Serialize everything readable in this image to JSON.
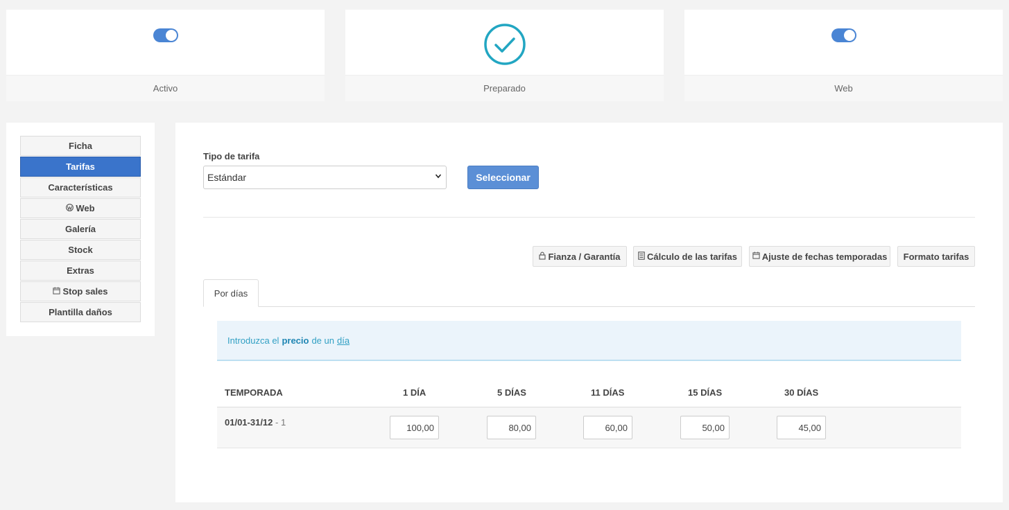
{
  "status_cards": {
    "activo": {
      "label": "Activo",
      "on": true
    },
    "preparado": {
      "label": "Preparado",
      "checked": true
    },
    "web": {
      "label": "Web",
      "on": true
    }
  },
  "colors": {
    "accent": "#3a74cb",
    "toggle": "#4a85d4",
    "check": "#22a6c2",
    "info_text": "#31a0c4"
  },
  "sidebar": {
    "items": [
      {
        "label": "Ficha",
        "icon": ""
      },
      {
        "label": "Tarifas",
        "icon": "",
        "active": true
      },
      {
        "label": "Características",
        "icon": ""
      },
      {
        "label": "Web",
        "icon": "wordpress-icon"
      },
      {
        "label": "Galería",
        "icon": ""
      },
      {
        "label": "Stock",
        "icon": ""
      },
      {
        "label": "Extras",
        "icon": ""
      },
      {
        "label": "Stop sales",
        "icon": "calendar-icon"
      },
      {
        "label": "Plantilla daños",
        "icon": ""
      }
    ]
  },
  "main": {
    "tipo_label": "Tipo de tarifa",
    "tipo_value": "Estándar",
    "select_button": "Seleccionar",
    "tools": {
      "fianza": "Fianza / Garantía",
      "calculo": "Cálculo de las tarifas",
      "ajuste": "Ajuste de fechas temporadas",
      "formato": "Formato tarifas"
    },
    "tab": "Por días",
    "info": {
      "pre": "Introduzca el",
      "bold": "precio",
      "mid": "de un",
      "link": "día"
    },
    "table": {
      "headers": [
        "TEMPORADA",
        "1 DÍA",
        "5 DÍAS",
        "11 DÍAS",
        "15 DÍAS",
        "30 DÍAS"
      ],
      "rows": [
        {
          "season": "01/01-31/12",
          "suffix": "- 1",
          "prices": [
            "100,00",
            "80,00",
            "60,00",
            "50,00",
            "45,00"
          ]
        }
      ]
    }
  }
}
